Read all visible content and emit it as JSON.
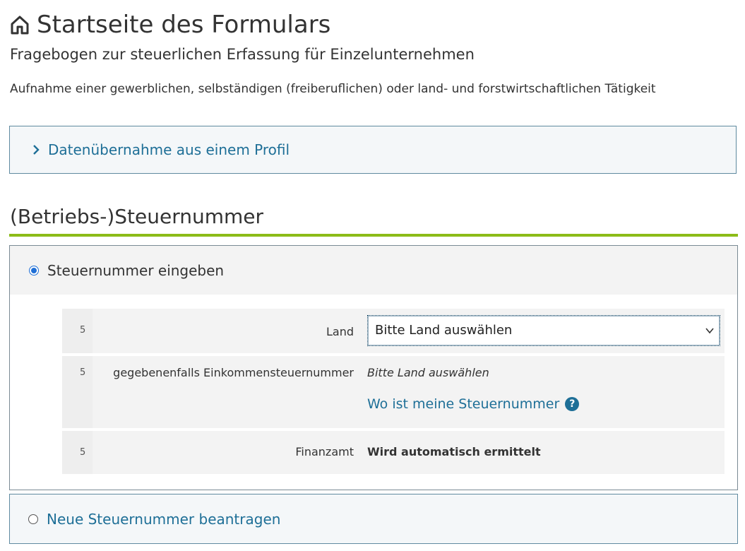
{
  "header": {
    "title": "Startseite des Formulars",
    "subtitle": "Fragebogen zur steuerlichen Erfassung für Einzelunternehmen",
    "description": "Aufnahme einer gewerblichen, selbständigen (freiberuflichen) oder land- und forstwirtschaftlichen Tätigkeit"
  },
  "import_accordion": {
    "label": "Datenübernahme aus einem Profil",
    "icon": "chevron-right-icon"
  },
  "section": {
    "title": "(Betriebs-)Steuernummer",
    "accent_color": "#8cbc18",
    "option_enter": {
      "label": "Steuernummer eingeben",
      "selected": true
    },
    "rows": [
      {
        "number": "5",
        "label": "Land",
        "select_value": "Bitte Land auswählen"
      },
      {
        "number": "5",
        "label": "gegebenenfalls Einkommensteuernummer",
        "hint": "Bitte Land auswählen",
        "link": "Wo ist meine Steuernummer",
        "help_icon": "?"
      },
      {
        "number": "5",
        "label": "Finanzamt",
        "value": "Wird automatisch ermittelt"
      }
    ],
    "option_new": {
      "label": "Neue Steuernummer beantragen",
      "selected": false
    }
  },
  "colors": {
    "link": "#1e6f97",
    "radio_selected": "#1f6fd6"
  }
}
